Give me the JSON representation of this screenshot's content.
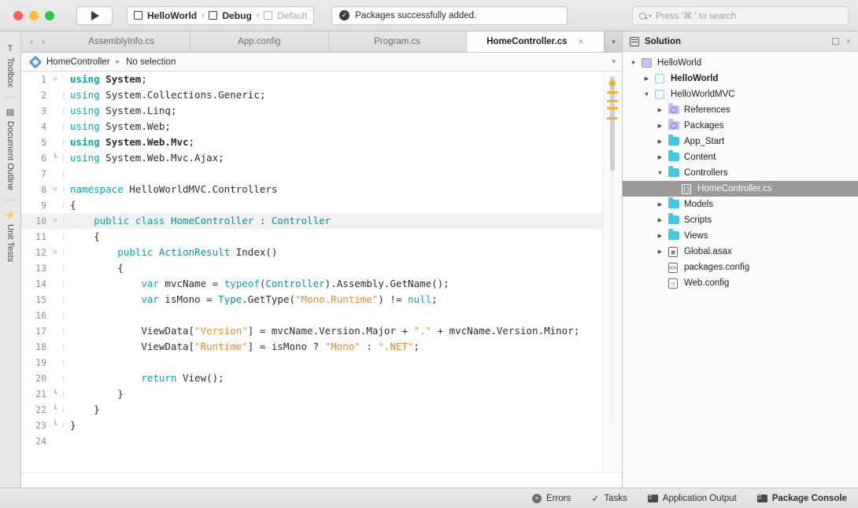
{
  "titlebar": {
    "run_button": "run-button",
    "config": {
      "project": "HelloWorld",
      "configuration": "Debug",
      "runtime": "Default",
      "sep": "›"
    },
    "status": {
      "text": "Packages successfully added.",
      "icon": "✓"
    },
    "search": {
      "placeholder": "Press '⌘.' to search"
    }
  },
  "leftrail": {
    "pads": [
      {
        "label": "Toolbox",
        "icon": "T"
      },
      {
        "label": "Document Outline",
        "icon": "▤"
      },
      {
        "label": "Unit Tests",
        "icon": "⚡"
      }
    ]
  },
  "tabbar": {
    "back": "‹",
    "forward": "›",
    "tabs": [
      {
        "label": "AssemblyInfo.cs",
        "active": false
      },
      {
        "label": "App.config",
        "active": false
      },
      {
        "label": "Program.cs",
        "active": false
      },
      {
        "label": "HomeController.cs",
        "active": true,
        "close": "×"
      }
    ],
    "overflow": "▾"
  },
  "breadcrumb": {
    "type": "HomeController",
    "arrow": "▸",
    "member": "No selection",
    "right_chevron": "▾"
  },
  "editor": {
    "current_line": 10,
    "lines": [
      {
        "n": 1,
        "fold": "⊖",
        "html": "<span class=\"kb\">using</span> <span class=\"bold p\">System</span><span class=\"p\">;</span>"
      },
      {
        "n": 2,
        "fold": "",
        "html": "<span class=\"k\">using</span> <span class=\"p\">System.Collections.Generic;</span>"
      },
      {
        "n": 3,
        "fold": "",
        "html": "<span class=\"k\">using</span> <span class=\"p\">System.Linq;</span>"
      },
      {
        "n": 4,
        "fold": "",
        "html": "<span class=\"k\">using</span> <span class=\"p\">System.Web;</span>"
      },
      {
        "n": 5,
        "fold": "",
        "html": "<span class=\"kb\">using</span> <span class=\"bold p\">System.Web.Mvc</span><span class=\"p\">;</span>"
      },
      {
        "n": 6,
        "fold": "┗",
        "html": "<span class=\"k\">using</span> <span class=\"p\">System.Web.Mvc.Ajax;</span>"
      },
      {
        "n": 7,
        "fold": "",
        "html": ""
      },
      {
        "n": 8,
        "fold": "⊖",
        "html": "<span class=\"k\">namespace</span> <span class=\"p\">HelloWorldMVC.Controllers</span>"
      },
      {
        "n": 9,
        "fold": "",
        "html": "<span class=\"p\">{</span>"
      },
      {
        "n": 10,
        "fold": "⊖",
        "html": "    <span class=\"k\">public class</span> <span class=\"t\">HomeController</span> <span class=\"p\">:</span> <span class=\"t\">Controller</span>"
      },
      {
        "n": 11,
        "fold": "",
        "html": "    <span class=\"p\">{</span>"
      },
      {
        "n": 12,
        "fold": "⊖",
        "html": "        <span class=\"k\">public</span> <span class=\"t\">ActionResult</span> <span class=\"p\">Index()</span>"
      },
      {
        "n": 13,
        "fold": "",
        "html": "        <span class=\"p\">{</span>"
      },
      {
        "n": 14,
        "fold": "",
        "html": "            <span class=\"k\">var</span> <span class=\"p\">mvcName =</span> <span class=\"k\">typeof</span><span class=\"p\">(</span><span class=\"t\">Controller</span><span class=\"p\">).Assembly.GetName();</span>"
      },
      {
        "n": 15,
        "fold": "",
        "html": "            <span class=\"k\">var</span> <span class=\"p\">isMono =</span> <span class=\"t\">Type</span><span class=\"p\">.GetType(</span><span class=\"s\">\"Mono.Runtime\"</span><span class=\"p\">) !=</span> <span class=\"k\">null</span><span class=\"p\">;</span>"
      },
      {
        "n": 16,
        "fold": "",
        "html": ""
      },
      {
        "n": 17,
        "fold": "",
        "html": "            <span class=\"p\">ViewData[</span><span class=\"s\">\"Version\"</span><span class=\"p\">] = mvcName.Version.Major +</span> <span class=\"s\">\".\"</span> <span class=\"p\">+ mvcName.Version.Minor;</span>"
      },
      {
        "n": 18,
        "fold": "",
        "html": "            <span class=\"p\">ViewData[</span><span class=\"s\">\"Runtime\"</span><span class=\"p\">] = isMono ?</span> <span class=\"s\">\"Mono\"</span> <span class=\"p\">:</span> <span class=\"s\">\".NET\"</span><span class=\"p\">;</span>"
      },
      {
        "n": 19,
        "fold": "",
        "html": ""
      },
      {
        "n": 20,
        "fold": "",
        "html": "            <span class=\"k\">return</span> <span class=\"p\">View();</span>"
      },
      {
        "n": 21,
        "fold": "┗",
        "html": "        <span class=\"p\">}</span>"
      },
      {
        "n": 22,
        "fold": "┗",
        "html": "    <span class=\"p\">}</span>"
      },
      {
        "n": 23,
        "fold": "┗",
        "html": "<span class=\"p\">}</span>"
      },
      {
        "n": 24,
        "fold": "",
        "html": ""
      }
    ],
    "markers": {
      "warning_color": "#f0b429",
      "dots": [
        99
      ],
      "lines": [
        113,
        124,
        133,
        146
      ]
    }
  },
  "solution": {
    "title": "Solution",
    "header_icons": [
      "restore-icon",
      "close-icon"
    ],
    "close": "×",
    "tree": [
      {
        "indent": 0,
        "disc": "▼",
        "icon": "solution",
        "label": "HelloWorld",
        "bold": false,
        "selected": false
      },
      {
        "indent": 1,
        "disc": "▶",
        "icon": "project",
        "label": "HelloWorld",
        "bold": true,
        "selected": false
      },
      {
        "indent": 1,
        "disc": "▼",
        "icon": "project",
        "label": "HelloWorldMVC",
        "bold": false,
        "selected": false
      },
      {
        "indent": 2,
        "disc": "▶",
        "icon": "folder-purple",
        "label": "References",
        "bold": false,
        "selected": false
      },
      {
        "indent": 2,
        "disc": "▶",
        "icon": "folder-purple",
        "label": "Packages",
        "bold": false,
        "selected": false
      },
      {
        "indent": 2,
        "disc": "▶",
        "icon": "folder",
        "label": "App_Start",
        "bold": false,
        "selected": false
      },
      {
        "indent": 2,
        "disc": "▶",
        "icon": "folder",
        "label": "Content",
        "bold": false,
        "selected": false
      },
      {
        "indent": 2,
        "disc": "▼",
        "icon": "folder",
        "label": "Controllers",
        "bold": false,
        "selected": false
      },
      {
        "indent": 3,
        "disc": "",
        "icon": "file-cs",
        "label": "HomeController.cs",
        "bold": false,
        "selected": true
      },
      {
        "indent": 2,
        "disc": "▶",
        "icon": "folder",
        "label": "Models",
        "bold": false,
        "selected": false
      },
      {
        "indent": 2,
        "disc": "▶",
        "icon": "folder",
        "label": "Scripts",
        "bold": false,
        "selected": false
      },
      {
        "indent": 2,
        "disc": "▶",
        "icon": "folder",
        "label": "Views",
        "bold": false,
        "selected": false
      },
      {
        "indent": 2,
        "disc": "▶",
        "icon": "file-asax",
        "label": "Global.asax",
        "bold": false,
        "selected": false
      },
      {
        "indent": 2,
        "disc": "",
        "icon": "file-xml",
        "label": "packages.config",
        "bold": false,
        "selected": false
      },
      {
        "indent": 2,
        "disc": "",
        "icon": "file-config",
        "label": "Web.config",
        "bold": false,
        "selected": false
      }
    ]
  },
  "bottombar": {
    "items": [
      {
        "label": "Errors",
        "icon": "error-icon",
        "active": false
      },
      {
        "label": "Tasks",
        "icon": "check-icon",
        "active": false
      },
      {
        "label": "Application Output",
        "icon": "console-icon",
        "active": false
      },
      {
        "label": "Package Console",
        "icon": "console-icon",
        "active": true
      }
    ]
  },
  "colors": {
    "keyword": "#119eab",
    "type": "#0f8c99",
    "string": "#e8892a",
    "warning": "#f0b429",
    "selection": "#9a9a9a",
    "folder_teal": "#45c7e0",
    "folder_purple": "#c6bbee"
  }
}
